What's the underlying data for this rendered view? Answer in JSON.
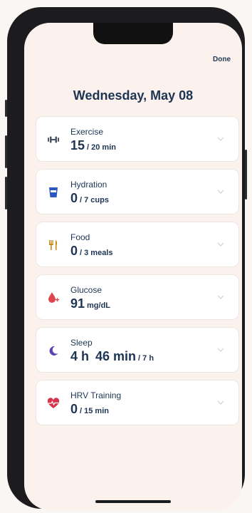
{
  "header": {
    "done_label": "Done",
    "date": "Wednesday, May 08"
  },
  "cards": [
    {
      "label": "Exercise",
      "value": "15",
      "unit": "/ 20 min",
      "icon": "dumbbell-icon",
      "color": "#4b5563"
    },
    {
      "label": "Hydration",
      "value": "0",
      "unit": "/ 7 cups",
      "icon": "cup-icon",
      "color": "#2b55c2"
    },
    {
      "label": "Food",
      "value": "0",
      "unit": "/ 3 meals",
      "icon": "utensils-icon",
      "color": "#c48a12"
    },
    {
      "label": "Glucose",
      "value": "91",
      "unit": "mg/dL",
      "icon": "drop-plus-icon",
      "color": "#e0464f"
    },
    {
      "label": "Sleep",
      "value": "4 h",
      "value2": "46 min",
      "unit": "/ 7 h",
      "icon": "moon-icon",
      "color": "#5b43b2"
    },
    {
      "label": "HRV Training",
      "value": "0",
      "unit": "/ 15 min",
      "icon": "heart-pulse-icon",
      "color": "#d6354a"
    }
  ]
}
